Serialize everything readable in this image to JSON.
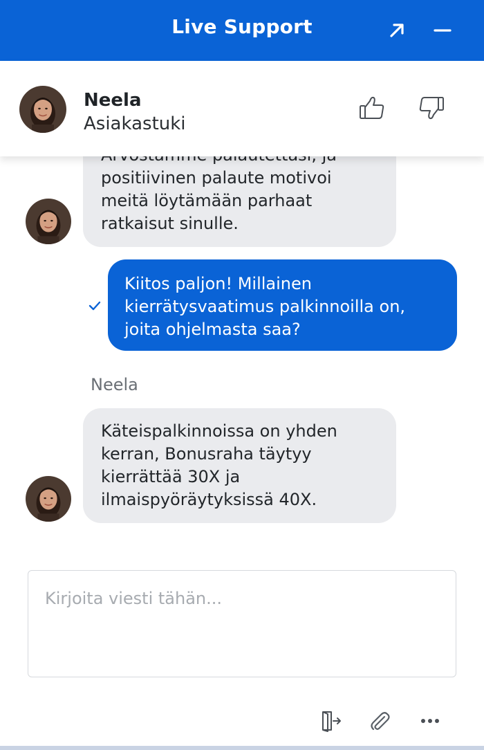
{
  "header": {
    "title": "Live Support",
    "expand_icon": "expand-arrow-icon",
    "minimize_icon": "minimize-icon"
  },
  "agent": {
    "name": "Neela",
    "role": "Asiakastuki"
  },
  "messages": [
    {
      "from": "agent",
      "text": "Arvostamme palautettasi, ja\npositiivinen palaute motivoi\nmeitä löytämään parhaat\nratkaisut sinulle."
    },
    {
      "from": "user",
      "text": "Kiitos paljon! Millainen\nkierrätysvaatimus palkinnoilla on,\njoita ohjelmasta saa?",
      "status": "sent"
    },
    {
      "from": "agent",
      "sender": "Neela",
      "text": "Käteispalkinnoissa on yhden\nkerran, Bonusraha täytyy\nkierrättää 30X ja\nilmaispyöräytyksissä 40X."
    }
  ],
  "composer": {
    "placeholder": "Kirjoita viesti tähän...",
    "value": ""
  },
  "toolbar": {
    "icons": [
      "exit-chat-icon",
      "paperclip-icon",
      "more-icon"
    ]
  },
  "colors": {
    "brand": "#0a63d6",
    "agent_bubble": "#eaebee",
    "user_bubble": "#0a63d6"
  }
}
